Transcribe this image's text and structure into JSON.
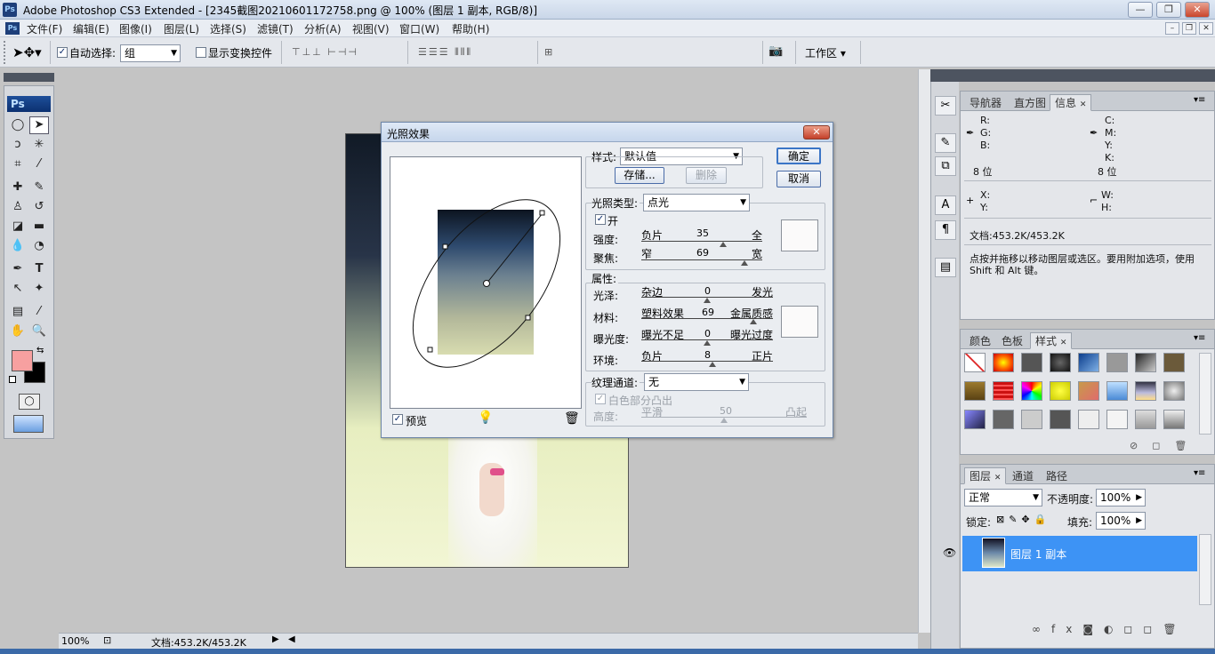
{
  "window": {
    "title": "Adobe Photoshop CS3 Extended - [2345截图20210601172758.png @ 100% (图层 1 副本, RGB/8)]",
    "app_icon": "Ps",
    "min_label": "—",
    "max_label": "❐",
    "close_label": "✕"
  },
  "menubar": {
    "items": [
      "文件(F)",
      "编辑(E)",
      "图像(I)",
      "图层(L)",
      "选择(S)",
      "滤镜(T)",
      "分析(A)",
      "视图(V)",
      "窗口(W)",
      "帮助(H)"
    ]
  },
  "options": {
    "auto_select_label": "自动选择:",
    "auto_select_value": "组",
    "show_transform_label": "显示变换控件",
    "workspace_label": "工作区 ▾"
  },
  "toolbox": {
    "logo": "Ps"
  },
  "status": {
    "zoom": "100%",
    "doc_info": "文档:453.2K/453.2K"
  },
  "info_panel": {
    "tabs": [
      "导航器",
      "直方图",
      "信息"
    ],
    "r": "R:",
    "g": "G:",
    "b": "B:",
    "c": "C:",
    "m": "M:",
    "y": "Y:",
    "k": "K:",
    "bits_left": "8 位",
    "bits_right": "8 位",
    "x": "X:",
    "y2": "Y:",
    "w": "W:",
    "h": "H:",
    "doc": "文档:453.2K/453.2K",
    "hint": "点按并拖移以移动图层或选区。要用附加选项，使用 Shift 和 Alt 键。"
  },
  "styles_panel": {
    "tabs": [
      "颜色",
      "色板",
      "样式"
    ]
  },
  "layers_panel": {
    "tabs": [
      "图层",
      "通道",
      "路径"
    ],
    "blend_mode": "正常",
    "opacity_label": "不透明度:",
    "opacity_value": "100%",
    "lock_label": "锁定:",
    "fill_label": "填充:",
    "fill_value": "100%",
    "layer_name": "图层 1 副本"
  },
  "dialog": {
    "title": "光照效果",
    "close": "✕",
    "ok": "确定",
    "cancel": "取消",
    "style_label": "样式:",
    "style_value": "默认值",
    "save": "存储...",
    "delete": "删除",
    "light_type_label": "光照类型:",
    "light_type_value": "点光",
    "on_label": "开",
    "intensity_label": "强度:",
    "intensity_left": "负片",
    "intensity_value": "35",
    "intensity_right": "全",
    "focus_label": "聚焦:",
    "focus_left": "窄",
    "focus_value": "69",
    "focus_right": "宽",
    "props_label": "属性:",
    "gloss_label": "光泽:",
    "gloss_left": "杂边",
    "gloss_value": "0",
    "gloss_right": "发光",
    "material_label": "材料:",
    "material_left": "塑料效果",
    "material_value": "69",
    "material_right": "金属质感",
    "exposure_label": "曝光度:",
    "exposure_left": "曝光不足",
    "exposure_value": "0",
    "exposure_right": "曝光过度",
    "ambience_label": "环境:",
    "ambience_left": "负片",
    "ambience_value": "8",
    "ambience_right": "正片",
    "texture_label": "纹理通道:",
    "texture_value": "无",
    "white_high_label": "白色部分凸出",
    "height_label": "高度:",
    "height_left": "平滑",
    "height_value": "50",
    "height_right": "凸起",
    "preview_label": "预览",
    "slider_fractions": {
      "intensity": 0.68,
      "focus": 0.85,
      "gloss": 0.5,
      "material": 0.85,
      "exposure": 0.5,
      "ambience": 0.54,
      "height": 0.5
    }
  }
}
